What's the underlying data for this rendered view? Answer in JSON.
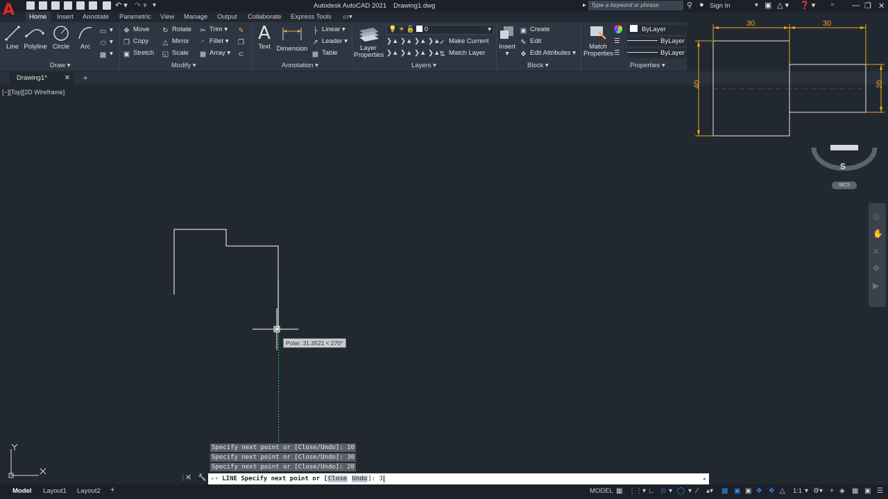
{
  "title_bar": {
    "app_title": "Autodesk AutoCAD 2021",
    "doc_title": "Drawing1.dwg",
    "search_placeholder": "Type a keyword or phrase",
    "sign_in": "Sign In"
  },
  "menu_tabs": [
    "Home",
    "Insert",
    "Annotate",
    "Parametric",
    "View",
    "Manage",
    "Output",
    "Collaborate",
    "Express Tools"
  ],
  "ribbon": {
    "draw": {
      "title": "Draw",
      "line": "Line",
      "polyline": "Polyline",
      "circle": "Circle",
      "arc": "Arc"
    },
    "modify": {
      "title": "Modify",
      "move": "Move",
      "rotate": "Rotate",
      "trim": "Trim",
      "copy": "Copy",
      "mirror": "Mirror",
      "fillet": "Fillet",
      "stretch": "Stretch",
      "scale": "Scale",
      "array": "Array"
    },
    "annotation": {
      "title": "Annotation",
      "text": "Text",
      "dimension": "Dimension",
      "linear": "Linear",
      "leader": "Leader",
      "table": "Table"
    },
    "layers": {
      "title": "Layers",
      "layer_properties_1": "Layer",
      "layer_properties_2": "Properties",
      "current_layer": "0",
      "make_current": "Make Current",
      "match_layer": "Match Layer"
    },
    "block": {
      "title": "Block",
      "insert": "Insert",
      "create": "Create",
      "edit": "Edit",
      "edit_attributes": "Edit Attributes"
    },
    "properties": {
      "title": "Properties",
      "match_1": "Match",
      "match_2": "Properties",
      "color": "ByLayer",
      "linetype": "ByLayer",
      "lineweight": "ByLayer"
    }
  },
  "doc_tab": "Drawing1*",
  "viewport_controls": "[−][Top][2D Wireframe]",
  "reference_dims": {
    "top_left": "30",
    "top_right": "30",
    "left": "40",
    "right": "20"
  },
  "viewcube": {
    "compass": "S",
    "wcs": "WCS"
  },
  "tooltip": "Polar: 31.3521 < 270°",
  "command_history": [
    "Specify next point or [Close/Undo]: 10",
    "Specify next point or [Close/Undo]: 30",
    "Specify next point or [Close/Undo]: 20"
  ],
  "command_line": {
    "prefix": "LINE Specify next point or [",
    "opt1": "Close",
    "opt2": "Undo",
    "suffix": "]: ",
    "value": "3"
  },
  "status_tabs": {
    "model": "Model",
    "layout1": "Layout1",
    "layout2": "Layout2"
  },
  "status": {
    "model_label": "MODEL",
    "scale": "1:1"
  }
}
